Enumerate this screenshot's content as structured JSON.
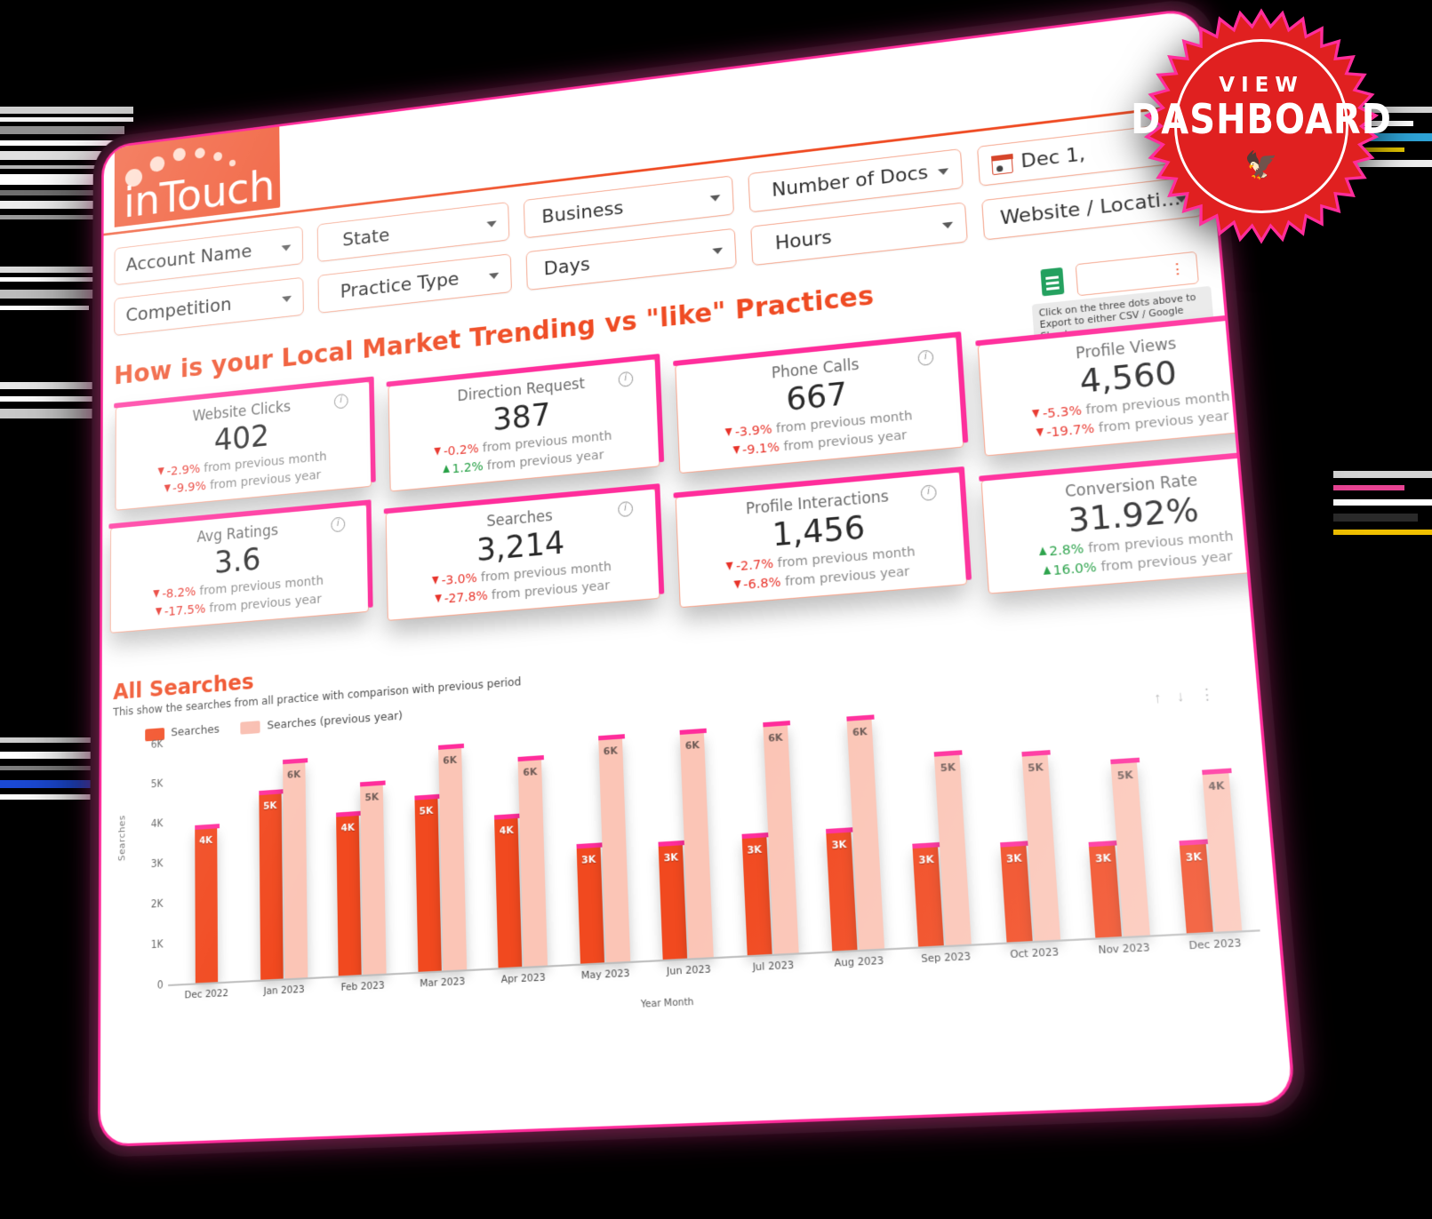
{
  "brand": {
    "logo_text": "inTouch"
  },
  "filters": {
    "row1": [
      {
        "label": "Account Name",
        "icon": "chevron-down-icon"
      },
      {
        "label": "State",
        "icon": "chevron-down-icon"
      },
      {
        "label": "Business",
        "icon": "chevron-down-icon"
      },
      {
        "label": "Number of Docs",
        "icon": "chevron-down-icon"
      },
      {
        "label": "Dec 1,",
        "icon": "calendar-icon"
      }
    ],
    "row2": [
      {
        "label": "Competition",
        "icon": "chevron-down-icon"
      },
      {
        "label": "Practice Type",
        "icon": "chevron-down-icon"
      },
      {
        "label": "Days",
        "icon": "chevron-down-icon"
      },
      {
        "label": "Hours",
        "icon": "chevron-down-icon"
      },
      {
        "label": "Website / Locati...",
        "icon": "chevron-down-icon"
      }
    ]
  },
  "section": {
    "title": "How is your Local Market Trending vs \"like\" Practices"
  },
  "export": {
    "kebab": "⋮",
    "hint": "Click on the three dots above to Export to either CSV / Google Sheets"
  },
  "kpis": [
    {
      "label": "Website Clicks",
      "value": "402",
      "month": "-2.9%",
      "month_dir": "down",
      "year": "-9.9%",
      "year_dir": "down",
      "month_suffix": "from previous month",
      "year_suffix": "from previous year"
    },
    {
      "label": "Direction Request",
      "value": "387",
      "month": "-0.2%",
      "month_dir": "down",
      "year": "1.2%",
      "year_dir": "up",
      "month_suffix": "from previous month",
      "year_suffix": "from previous year"
    },
    {
      "label": "Phone Calls",
      "value": "667",
      "month": "-3.9%",
      "month_dir": "down",
      "year": "-9.1%",
      "year_dir": "down",
      "month_suffix": "from previous month",
      "year_suffix": "from previous year"
    },
    {
      "label": "Profile Views",
      "value": "4,560",
      "month": "-5.3%",
      "month_dir": "down",
      "year": "-19.7%",
      "year_dir": "down",
      "month_suffix": "from previous month",
      "year_suffix": "from previous year"
    },
    {
      "label": "Avg Ratings",
      "value": "3.6",
      "month": "-8.2%",
      "month_dir": "down",
      "year": "-17.5%",
      "year_dir": "down",
      "month_suffix": "from previous month",
      "year_suffix": "from previous year"
    },
    {
      "label": "Searches",
      "value": "3,214",
      "month": "-3.0%",
      "month_dir": "down",
      "year": "-27.8%",
      "year_dir": "down",
      "month_suffix": "from previous month",
      "year_suffix": "from previous year"
    },
    {
      "label": "Profile Interactions",
      "value": "1,456",
      "month": "-2.7%",
      "month_dir": "down",
      "year": "-6.8%",
      "year_dir": "down",
      "month_suffix": "from previous month",
      "year_suffix": "from previous year"
    },
    {
      "label": "Conversion Rate",
      "value": "31.92%",
      "month": "2.8%",
      "month_dir": "up",
      "year": "16.0%",
      "year_dir": "up",
      "month_suffix": "from previous month",
      "year_suffix": "from previous year"
    }
  ],
  "chart_header": {
    "title": "All Searches",
    "subtitle": "This show the searches from all practice with comparison with previous period",
    "tools": [
      "sort-asc-icon",
      "sort-desc-icon",
      "more-options-icon"
    ]
  },
  "chart_data": {
    "type": "bar",
    "title": "All Searches",
    "xlabel": "Year Month",
    "ylabel": "Searches",
    "ylim": [
      0,
      6500
    ],
    "yticks": [
      "6K",
      "5K",
      "4K",
      "3K",
      "2K",
      "1K",
      "0"
    ],
    "grid": false,
    "legend_position": "top-left",
    "categories": [
      "Dec 2022",
      "Jan 2023",
      "Feb 2023",
      "Mar 2023",
      "Apr 2023",
      "May 2023",
      "Jun 2023",
      "Jul 2023",
      "Aug 2023",
      "Sep 2023",
      "Oct 2023",
      "Nov 2023",
      "Dec 2023"
    ],
    "series": [
      {
        "name": "Searches",
        "color": "#f1491f",
        "values": [
          4100,
          4900,
          4200,
          4500,
          3850,
          2950,
          2900,
          2950,
          2950,
          2450,
          2350,
          2250,
          2150
        ],
        "labels": [
          "4K",
          "5K",
          "4K",
          "5K",
          "4K",
          "3K",
          "3K",
          "3K",
          "3K",
          "3K",
          "3K",
          "3K",
          "3K"
        ]
      },
      {
        "name": "Searches (previous year)",
        "color": "#fbc5b6",
        "values": [
          0,
          5700,
          4950,
          5800,
          5350,
          5750,
          5750,
          5800,
          5800,
          4750,
          4600,
          4250,
          3850
        ],
        "labels": [
          "",
          "6K",
          "5K",
          "6K",
          "6K",
          "6K",
          "6K",
          "6K",
          "6K",
          "5K",
          "5K",
          "5K",
          "4K"
        ]
      }
    ]
  },
  "badge": {
    "line1": "VIEW",
    "line2": "DASHBOARD",
    "bird": "bird-icon"
  }
}
